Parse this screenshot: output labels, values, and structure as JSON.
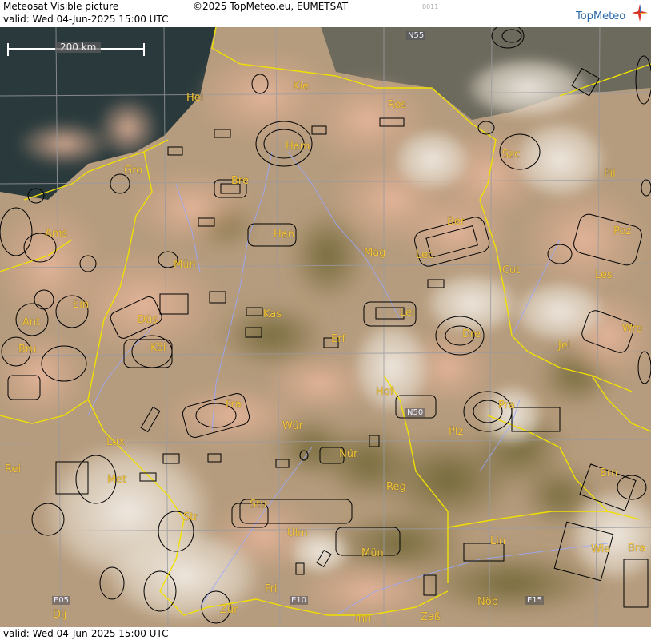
{
  "header": {
    "title": "Meteosat Visible picture",
    "copyright": "©2025 TopMeteo.eu, EUMETSAT",
    "code": "8011",
    "valid": "valid:  Wed  04-Jun-2025  15:00 UTC",
    "logo": "TopMeteo"
  },
  "footer": {
    "valid": "valid:  Wed  04-Jun-2025  15:00 UTC"
  },
  "scale": {
    "label": "200 km"
  },
  "grid_labels": [
    "N55",
    "N50",
    "E05",
    "E10",
    "E15"
  ],
  "cities": [
    "Hel",
    "Kie",
    "Ros",
    "Ham",
    "Gro",
    "Bre",
    "Szc",
    "Pil",
    "Ber",
    "Ams",
    "Han",
    "Mag",
    "Poz",
    "Mün",
    "Lec",
    "Cot",
    "Les",
    "Ein",
    "Düs",
    "Kas",
    "Lei",
    "Ant",
    "Köl",
    "Erf",
    "Dre",
    "Wro",
    "Bru",
    "Jel",
    "Hof",
    "Fra",
    "Pra",
    "Wür",
    "Plz",
    "Lux",
    "Nür",
    "Rei",
    "Met",
    "Brn",
    "Reg",
    "Stu",
    "Str",
    "Ulm",
    "Lin",
    "Mün",
    "Wie",
    "Bra",
    "Fri",
    "Dij",
    "Zür",
    "Inn",
    "Zaß",
    "Nöb"
  ],
  "colors": {
    "border": "#f0e000",
    "graticule": "#9a9aa0",
    "rivers": "#9aa8ff",
    "city": "#f4c63a"
  }
}
